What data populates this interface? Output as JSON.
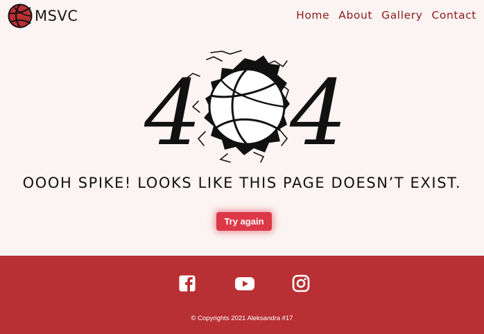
{
  "brand": {
    "name": "MSVC",
    "logo_icon": "volleyball-icon"
  },
  "nav": {
    "items": [
      {
        "label": "Home"
      },
      {
        "label": "About"
      },
      {
        "label": "Gallery"
      },
      {
        "label": "Contact"
      }
    ]
  },
  "hero": {
    "code_left": "4",
    "code_right": "4",
    "ball_icon": "volleyball-icon"
  },
  "message": "Oooh spike! Looks like this page doesn’t exist.",
  "button": {
    "label": "Try again"
  },
  "footer": {
    "social": [
      {
        "icon": "facebook-icon"
      },
      {
        "icon": "youtube-icon"
      },
      {
        "icon": "instagram-icon"
      }
    ],
    "copyright": "© Copyrights 2021 Aleksandra #17"
  },
  "colors": {
    "accent": "#dc3848",
    "footer_bg": "#b93034",
    "nav_link": "#8b1a1a",
    "page_bg": "#fbf4f3"
  }
}
